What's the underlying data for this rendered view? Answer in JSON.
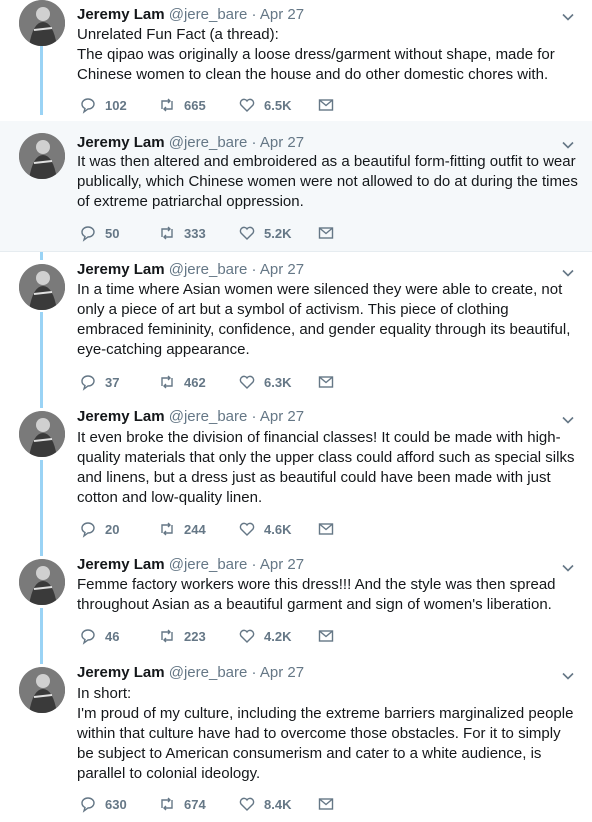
{
  "tweets": [
    {
      "name": "Jeremy Lam",
      "handle": "@jere_bare",
      "separator": "·",
      "date": "Apr 27",
      "text": "Unrelated Fun Fact (a thread):\nThe qipao was originally a loose dress/garment without shape, made for Chinese women to clean the house and do other domestic chores with.",
      "replies": "102",
      "retweets": "665",
      "likes": "6.5K"
    },
    {
      "name": "Jeremy Lam",
      "handle": "@jere_bare",
      "separator": "·",
      "date": "Apr 27",
      "text": "It was then altered and embroidered as a beautiful form-fitting outfit to wear publically, which Chinese women were not allowed to do at during the times of extreme patriarchal oppression.",
      "replies": "50",
      "retweets": "333",
      "likes": "5.2K"
    },
    {
      "name": "Jeremy Lam",
      "handle": "@jere_bare",
      "separator": "·",
      "date": "Apr 27",
      "text": "In a time where Asian women were silenced they were able to create, not only a piece of art but a symbol of activism. This piece of clothing embraced femininity, confidence, and gender equality through its beautiful, eye-catching appearance.",
      "replies": "37",
      "retweets": "462",
      "likes": "6.3K"
    },
    {
      "name": "Jeremy Lam",
      "handle": "@jere_bare",
      "separator": "·",
      "date": "Apr 27",
      "text": "It even broke the division of financial classes! It could be made with high-quality materials that only the upper class could afford such as special silks and linens, but a dress just as beautiful could have been made with just cotton and low-quality linen.",
      "replies": "20",
      "retweets": "244",
      "likes": "4.6K"
    },
    {
      "name": "Jeremy Lam",
      "handle": "@jere_bare",
      "separator": "·",
      "date": "Apr 27",
      "text": "Femme factory workers wore this dress!!! And the style was then spread throughout Asian as a beautiful garment and sign of women's liberation.",
      "replies": "46",
      "retweets": "223",
      "likes": "4.2K"
    },
    {
      "name": "Jeremy Lam",
      "handle": "@jere_bare",
      "separator": "·",
      "date": "Apr 27",
      "text": "In short:\nI'm proud of my culture, including the extreme barriers marginalized people within that culture have had to overcome those obstacles. For it to simply be subject to American consumerism and cater to a white audience, is parallel to colonial ideology.",
      "replies": "630",
      "retweets": "674",
      "likes": "8.4K"
    }
  ],
  "colors": {
    "thread_line": "#9ad3f5",
    "highlight_bg": "#f5f8fa",
    "secondary_text": "#657786",
    "primary_text": "#14171a"
  },
  "icons": {
    "reply": "reply-icon",
    "retweet": "retweet-icon",
    "like": "like-icon",
    "dm": "direct-message-icon",
    "menu": "chevron-down-icon",
    "avatar": "avatar"
  }
}
